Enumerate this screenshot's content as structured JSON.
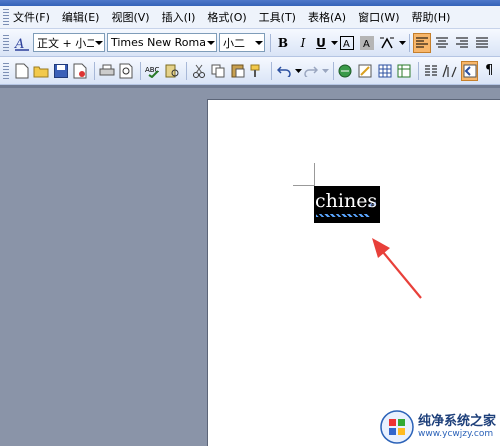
{
  "menu": {
    "items": [
      "文件(F)",
      "编辑(E)",
      "视图(V)",
      "插入(I)",
      "格式(O)",
      "工具(T)",
      "表格(A)",
      "窗口(W)",
      "帮助(H)"
    ]
  },
  "formatting": {
    "style_value": "正文 + 小二",
    "font_value": "Times New Roman",
    "size_value": "小二",
    "bold": "B",
    "italic": "I",
    "underline": "U"
  },
  "document": {
    "selected_text": "chines",
    "paragraph_mark": "↵",
    "selection_color": "#000000",
    "annotation_arrow_color": "#e8403a"
  },
  "watermark": {
    "title": "纯净系统之家",
    "url": "www.ycwjzy.com"
  }
}
